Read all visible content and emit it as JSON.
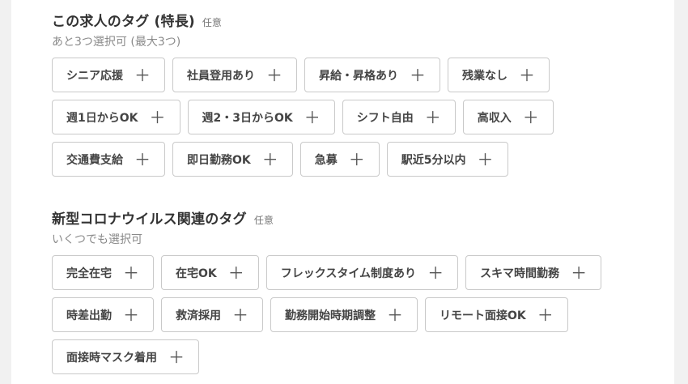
{
  "section1": {
    "title": "この求人のタグ (特長)",
    "optional": "任意",
    "subtitle": "あと3つ選択可 (最大3つ)",
    "chips": [
      {
        "label": "シニア応援"
      },
      {
        "label": "社員登用あり"
      },
      {
        "label": "昇給・昇格あり"
      },
      {
        "label": "残業なし"
      },
      {
        "label": "週1日からOK"
      },
      {
        "label": "週2・3日からOK"
      },
      {
        "label": "シフト自由"
      },
      {
        "label": "高収入"
      },
      {
        "label": "交通費支給"
      },
      {
        "label": "即日勤務OK"
      },
      {
        "label": "急募"
      },
      {
        "label": "駅近5分以内"
      }
    ]
  },
  "section2": {
    "title": "新型コロナウイルス関連のタグ",
    "optional": "任意",
    "subtitle": "いくつでも選択可",
    "chips": [
      {
        "label": "完全在宅"
      },
      {
        "label": "在宅OK"
      },
      {
        "label": "フレックスタイム制度あり"
      },
      {
        "label": "スキマ時間勤務"
      },
      {
        "label": "時差出勤"
      },
      {
        "label": "救済採用"
      },
      {
        "label": "勤務開始時期調整"
      },
      {
        "label": "リモート面接OK"
      },
      {
        "label": "面接時マスク着用"
      }
    ]
  },
  "icons": {
    "add": "plus-icon",
    "add_glyph": "＋"
  }
}
